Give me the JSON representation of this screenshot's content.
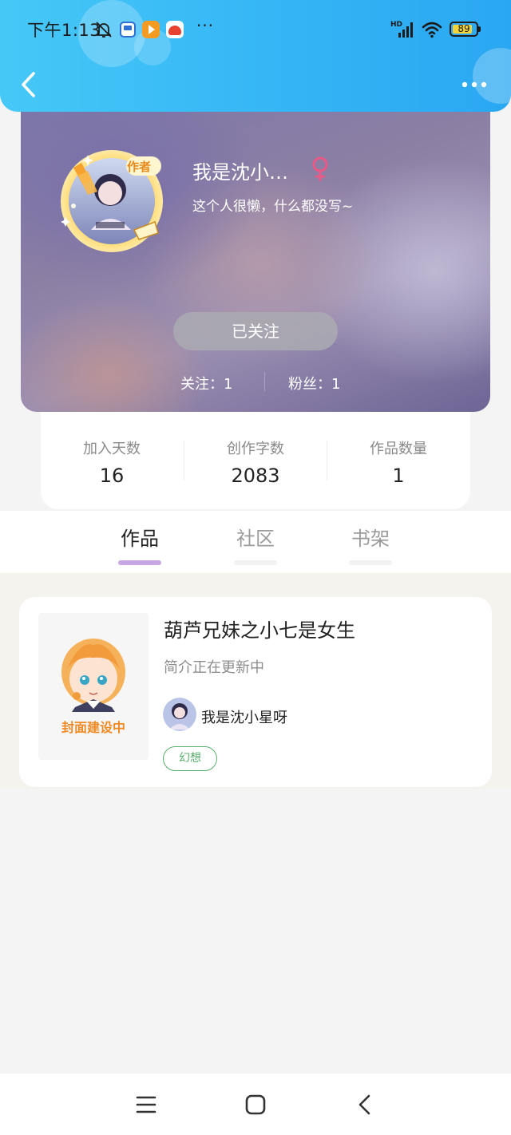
{
  "status_bar": {
    "time": "下午1:13",
    "more": "···",
    "network": "HD",
    "battery_level": "89",
    "battery_fraction": 0.89,
    "icons": [
      "bell-mute-icon",
      "app-notification-icon",
      "video-app-icon",
      "game-app-icon",
      "signal-icon",
      "wifi-icon",
      "battery-icon"
    ]
  },
  "nav": {
    "back_icon": "chevron-left-icon",
    "more_icon": "more-dots-icon",
    "accent": "#35b5f5"
  },
  "profile": {
    "name": "我是沈小…",
    "gender_icon": "female-icon",
    "gender_color": "#e95a86",
    "avatar_badge": "作者",
    "bio": "这个人很懒，什么都没写~",
    "follow_button": "已关注",
    "following": "关注：1",
    "followers": "粉丝：1"
  },
  "stats": [
    {
      "label": "加入天数",
      "value": "16"
    },
    {
      "label": "创作字数",
      "value": "2083"
    },
    {
      "label": "作品数量",
      "value": "1"
    }
  ],
  "tabs": [
    {
      "label": "作品",
      "active": true
    },
    {
      "label": "社区",
      "active": false
    },
    {
      "label": "书架",
      "active": false
    }
  ],
  "works": [
    {
      "cover_caption": "封面建设中",
      "title": "葫芦兄妹之小七是女生",
      "intro": "简介正在更新中",
      "author": "我是沈小星呀",
      "tag": "幻想",
      "tag_color": "#58b06a"
    }
  ],
  "system_nav": {
    "icons": [
      "menu-icon",
      "home-icon",
      "back-icon"
    ]
  }
}
